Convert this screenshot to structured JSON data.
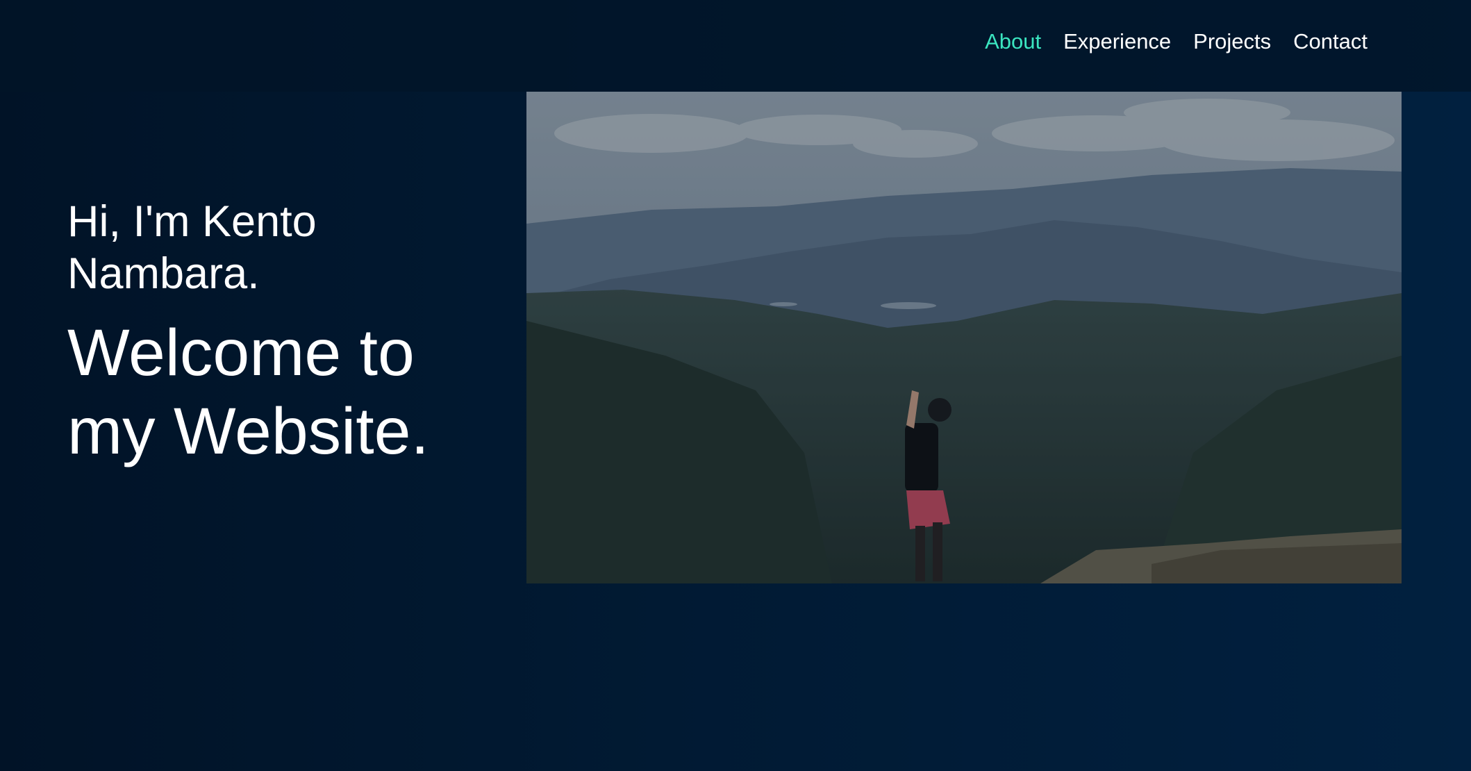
{
  "nav": {
    "items": [
      {
        "label": "About",
        "active": true
      },
      {
        "label": "Experience",
        "active": false
      },
      {
        "label": "Projects",
        "active": false
      },
      {
        "label": "Contact",
        "active": false
      }
    ],
    "active_color": "#3be5c0"
  },
  "hero": {
    "greeting": "Hi, I'm Kento Nambara.",
    "welcome": "Welcome to my Website."
  },
  "colors": {
    "background": "#011a33",
    "text": "#ffffff",
    "accent": "#3be5c0"
  }
}
